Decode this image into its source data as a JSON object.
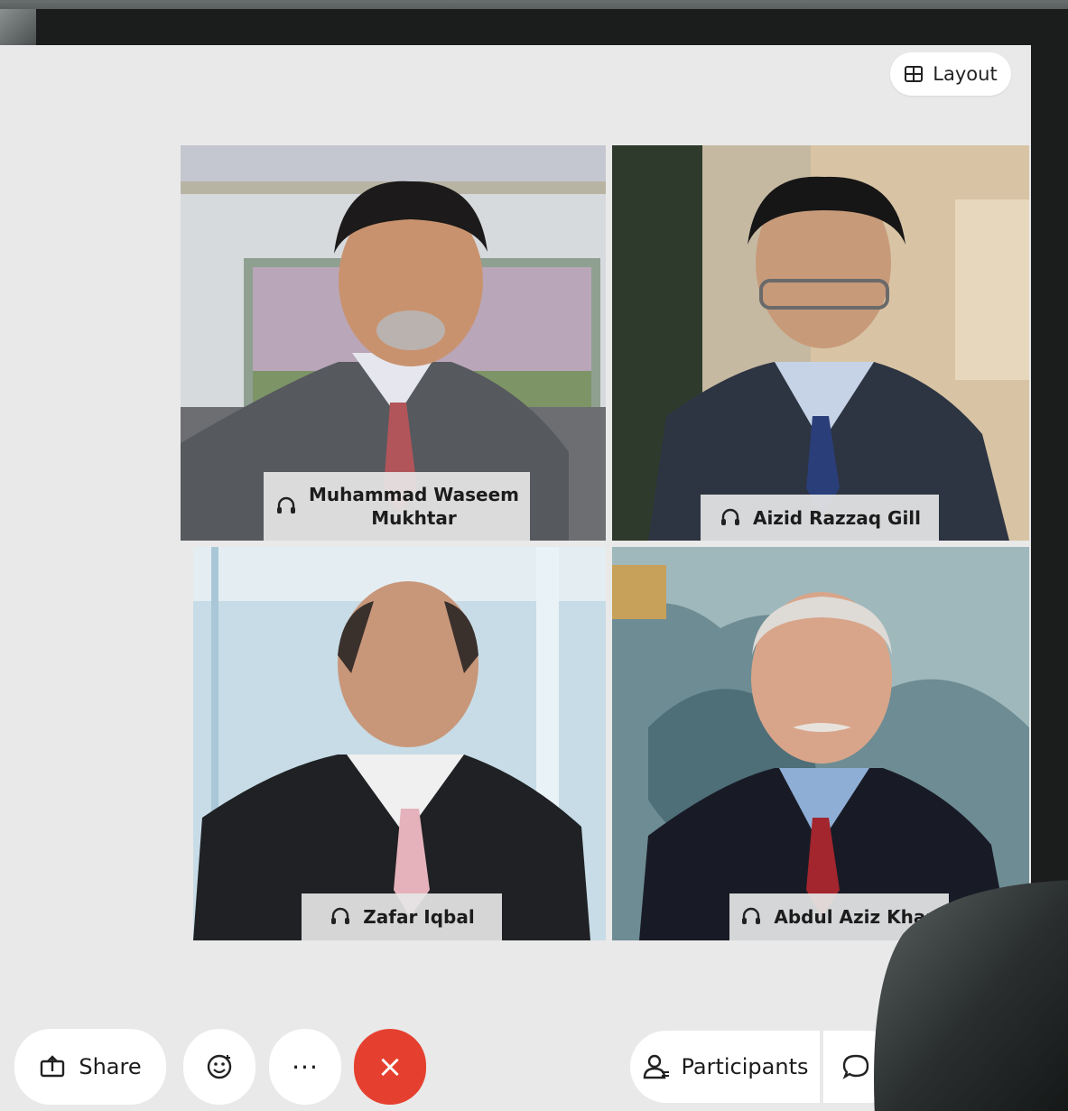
{
  "toolbar_top": {
    "layout_label": "Layout",
    "layout_icon": "grid-icon"
  },
  "participants": [
    {
      "name_line1": "Muhammad Waseem",
      "name_line2": "Mukhtar",
      "status_icon": "headset-icon"
    },
    {
      "name_line1": "Aizid Razzaq Gill",
      "name_line2": "",
      "status_icon": "headset-icon"
    },
    {
      "name_line1": "Zafar Iqbal",
      "name_line2": "",
      "status_icon": "headset-icon"
    },
    {
      "name_line1": "Abdul Aziz Khan",
      "name_line2": "",
      "status_icon": "headset-icon"
    }
  ],
  "controls": {
    "share_label": "Share",
    "share_icon": "share-screen-icon",
    "reaction_icon": "emoji-icon",
    "more_label": "···",
    "leave_label": "×",
    "participants_label": "Participants",
    "participants_icon": "person-icon",
    "chat_icon": "chat-bubble-icon"
  },
  "colors": {
    "screen_bg": "#e9e9e9",
    "leave_red": "#e5402f",
    "pill_bg": "#ffffff",
    "bezel": "#1b1d1d"
  }
}
